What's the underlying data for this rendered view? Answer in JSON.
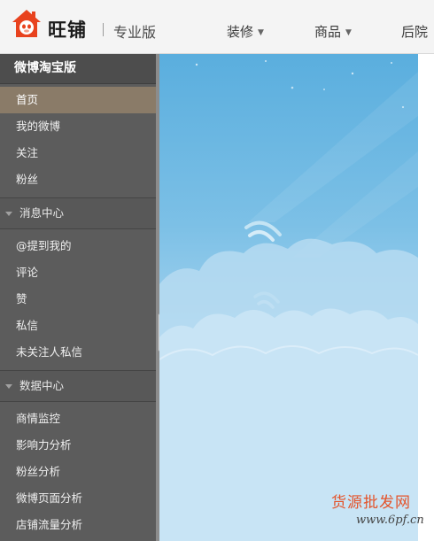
{
  "header": {
    "brand": "旺铺",
    "edition": "专业版",
    "nav": [
      {
        "label": "装修",
        "has_dropdown": true
      },
      {
        "label": "商品",
        "has_dropdown": true
      },
      {
        "label": "后院",
        "has_dropdown": false
      }
    ],
    "logo_color": "#e8421e"
  },
  "sidebar": {
    "title": "微博淘宝版",
    "items_top": [
      {
        "label": "首页",
        "active": true
      },
      {
        "label": "我的微博"
      },
      {
        "label": "关注"
      },
      {
        "label": "粉丝"
      }
    ],
    "group_messages": {
      "label": "消息中心",
      "items": [
        {
          "label": "@提到我的"
        },
        {
          "label": "评论"
        },
        {
          "label": "赞"
        },
        {
          "label": "私信"
        },
        {
          "label": "未关注人私信"
        }
      ]
    },
    "group_data": {
      "label": "数据中心",
      "items": [
        {
          "label": "商情监控"
        },
        {
          "label": "影响力分析"
        },
        {
          "label": "粉丝分析"
        },
        {
          "label": "微博页面分析"
        },
        {
          "label": "店铺流量分析"
        }
      ]
    }
  },
  "watermark": {
    "line1": "货源批发网",
    "line2": "www.6pf.cn"
  },
  "colors": {
    "sidebar_bg": "#5c5c5c",
    "active_item": "#8a7b68",
    "sky_top": "#5aaede",
    "sky_bottom": "#c3e1f5",
    "watermark": "#e4532a"
  }
}
